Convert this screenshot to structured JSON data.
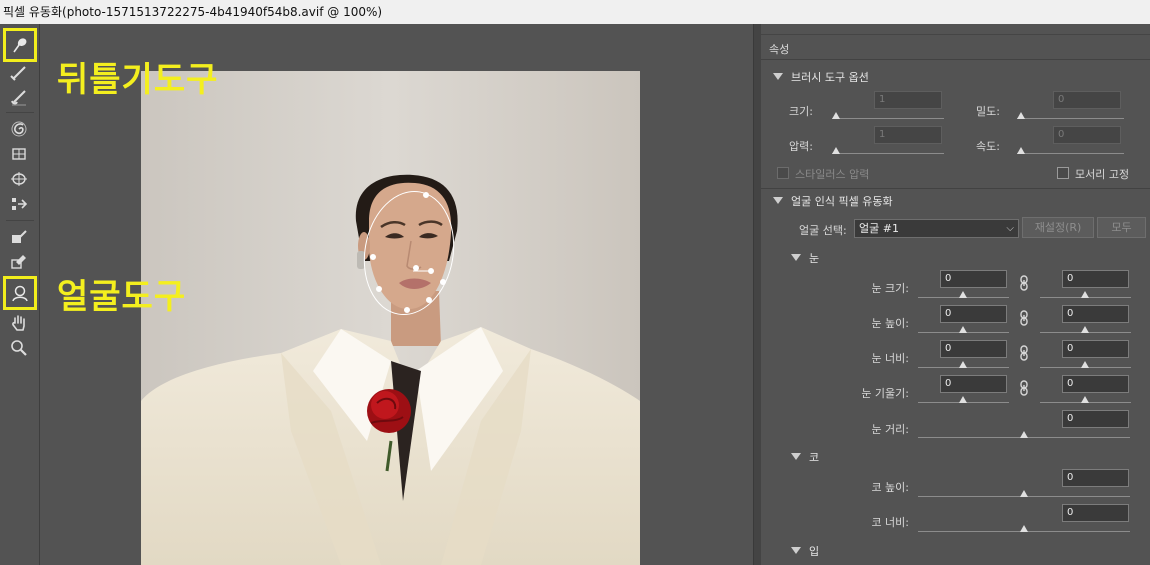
{
  "window": {
    "title": "픽셀 유동화(photo-1571513722275-4b41940f54b8.avif @ 100%)"
  },
  "toolbar": {
    "tools": [
      {
        "name": "forward-warp-tool",
        "icon": "warp-icon",
        "highlighted": true
      },
      {
        "name": "reconstruct-tool",
        "icon": "reconstruct-brush-icon"
      },
      {
        "name": "smooth-tool",
        "icon": "smooth-brush-icon"
      },
      {
        "name": "twirl-tool",
        "icon": "twirl-icon"
      },
      {
        "name": "pucker-tool",
        "icon": "pucker-icon"
      },
      {
        "name": "bloat-tool",
        "icon": "bloat-icon"
      },
      {
        "name": "push-left-tool",
        "icon": "push-left-icon"
      },
      {
        "name": "freeze-mask-tool",
        "icon": "freeze-mask-icon"
      },
      {
        "name": "thaw-mask-tool",
        "icon": "thaw-mask-icon"
      },
      {
        "name": "face-tool",
        "icon": "face-icon",
        "highlighted": true
      },
      {
        "name": "hand-tool",
        "icon": "hand-icon"
      },
      {
        "name": "zoom-tool",
        "icon": "zoom-icon"
      }
    ]
  },
  "annotations": {
    "warp_label": "뒤틀기도구",
    "face_label": "얼굴도구",
    "color": "#f4ef1e"
  },
  "panel": {
    "title": "속성",
    "brush": {
      "header": "브러시 도구 옵션",
      "size_label": "크기:",
      "size_value": "1",
      "density_label": "밀도:",
      "density_value": "0",
      "pressure_label": "압력:",
      "pressure_value": "1",
      "rate_label": "속도:",
      "rate_value": "0",
      "stylus_label": "스타일러스 압력",
      "pin_edges_label": "모서리 고정"
    },
    "face": {
      "header": "얼굴 인식 픽셀 유동화",
      "select_label": "얼굴 선택:",
      "select_value": "얼굴 #1",
      "reset_label": "재설정(R)",
      "all_label": "모두",
      "eyes": {
        "header": "눈",
        "rows": [
          {
            "label": "눈 크기:",
            "left": "0",
            "right": "0"
          },
          {
            "label": "눈 높이:",
            "left": "0",
            "right": "0"
          },
          {
            "label": "눈 너비:",
            "left": "0",
            "right": "0"
          },
          {
            "label": "눈 기울기:",
            "left": "0",
            "right": "0"
          }
        ],
        "distance_label": "눈 거리:",
        "distance_value": "0"
      },
      "nose": {
        "header": "코",
        "height_label": "코 높이:",
        "height_value": "0",
        "width_label": "코 너비:",
        "width_value": "0"
      },
      "mouth": {
        "header": "입"
      }
    }
  }
}
